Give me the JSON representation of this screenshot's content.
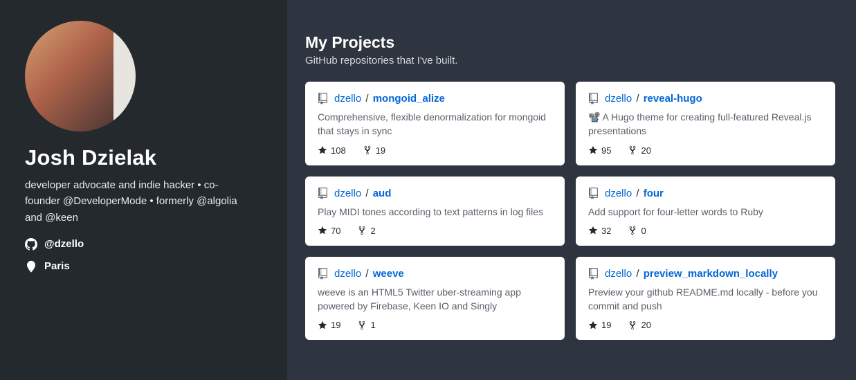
{
  "profile": {
    "name": "Josh Dzielak",
    "bio": "developer advocate and indie hacker • co-founder @DeveloperMode • formerly @algolia and @keen",
    "handle": "@dzello",
    "location": "Paris"
  },
  "section": {
    "title": "My Projects",
    "subtitle": "GitHub repositories that I've built."
  },
  "repos": [
    {
      "owner": "dzello",
      "name": "mongoid_alize",
      "desc": "Comprehensive, flexible denormalization for mongoid that stays in sync",
      "stars": "108",
      "forks": "19"
    },
    {
      "owner": "dzello",
      "name": "reveal-hugo",
      "desc": "📽️ A Hugo theme for creating full-featured Reveal.js presentations",
      "stars": "95",
      "forks": "20"
    },
    {
      "owner": "dzello",
      "name": "aud",
      "desc": "Play MIDI tones according to text patterns in log files",
      "stars": "70",
      "forks": "2"
    },
    {
      "owner": "dzello",
      "name": "four",
      "desc": "Add support for four-letter words to Ruby",
      "stars": "32",
      "forks": "0"
    },
    {
      "owner": "dzello",
      "name": "weeve",
      "desc": "weeve is an HTML5 Twitter uber-streaming app powered by Firebase, Keen IO and Singly",
      "stars": "19",
      "forks": "1"
    },
    {
      "owner": "dzello",
      "name": "preview_markdown_locally",
      "desc": "Preview your github README.md locally - before you commit and push",
      "stars": "19",
      "forks": "20"
    }
  ]
}
